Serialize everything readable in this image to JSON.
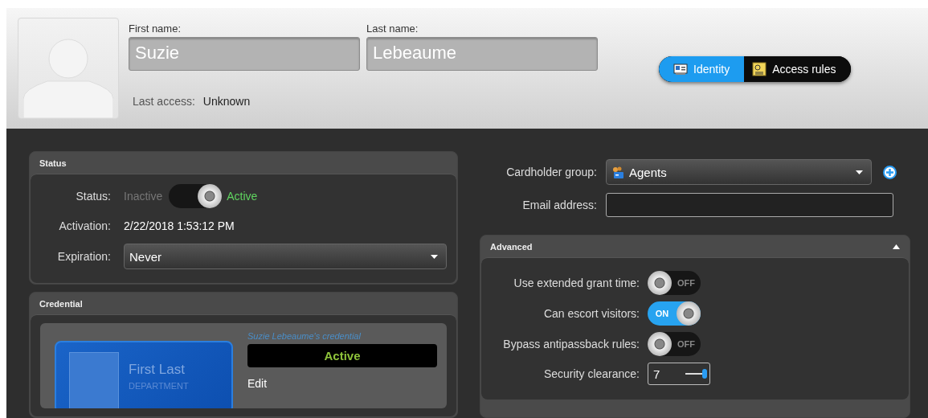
{
  "identity": {
    "first_name_label": "First name:",
    "first_name": "Suzie",
    "last_name_label": "Last name:",
    "last_name": "Lebeaume",
    "last_access_label": "Last access:",
    "last_access": "Unknown"
  },
  "tabs": [
    {
      "label": "Identity",
      "selected": true
    },
    {
      "label": "Access rules",
      "selected": false
    }
  ],
  "status": {
    "title": "Status",
    "toggle_label": "Status:",
    "off_label": "Inactive",
    "on_label": "Active",
    "on": true,
    "activation_label": "Activation:",
    "activation": "2/22/2018 1:53:12 PM",
    "expiration_label": "Expiration:",
    "expiration": "Never"
  },
  "credential": {
    "title": "Credential",
    "card_name": "First Last",
    "card_department": "DEPARTMENT",
    "name": "Suzie Lebeaume's credential",
    "state": "Active",
    "edit": "Edit"
  },
  "cardholder_group": {
    "label": "Cardholder group:",
    "value": "Agents"
  },
  "email": {
    "label": "Email address:"
  },
  "advanced": {
    "title": "Advanced",
    "expanded": true,
    "rows": [
      {
        "kind": "switch",
        "label": "Use extended grant time:",
        "on": false,
        "state_text": "OFF"
      },
      {
        "kind": "switch",
        "label": "Can escort visitors:",
        "on": true,
        "state_text": "ON"
      },
      {
        "kind": "switch",
        "label": "Bypass antipassback rules:",
        "on": false,
        "state_text": "OFF"
      },
      {
        "kind": "slider-field",
        "label": "Security clearance:",
        "value": "7",
        "level": 1
      }
    ]
  }
}
